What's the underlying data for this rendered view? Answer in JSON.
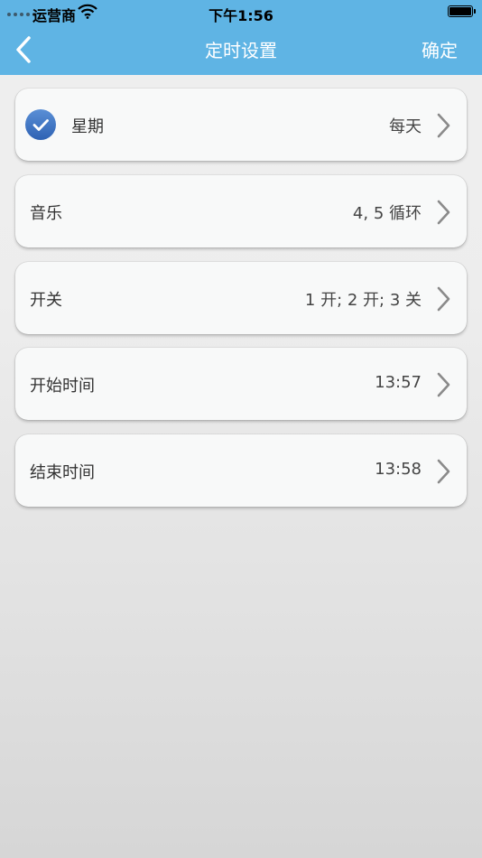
{
  "status_bar": {
    "carrier": "运营商",
    "time": "下午1:56",
    "wifi_icon": "wifi-icon",
    "battery_icon": "battery-icon"
  },
  "nav": {
    "title": "定时设置",
    "confirm_label": "确定",
    "back_icon": "chevron-left-icon"
  },
  "colors": {
    "header": "#5fb4e4",
    "check": "#2e62b4"
  },
  "rows": [
    {
      "label": "星期",
      "value": "每天",
      "checked": true
    },
    {
      "label": "音乐",
      "value": "4, 5 循环"
    },
    {
      "label": "开关",
      "value": "1 开; 2 开; 3 关"
    },
    {
      "label": "开始时间",
      "value": "13:57"
    },
    {
      "label": "结束时间",
      "value": "13:58"
    }
  ]
}
